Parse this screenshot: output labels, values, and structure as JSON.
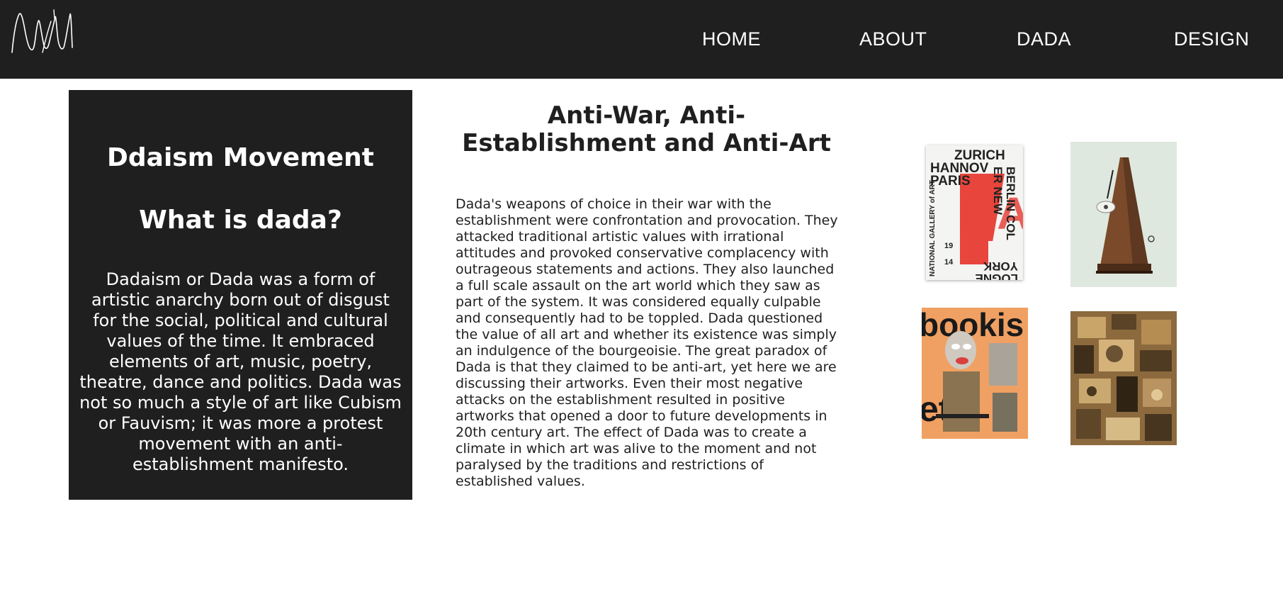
{
  "nav": {
    "logo": "logo-icon",
    "links": [
      "HOME",
      "ABOUT",
      "DADA",
      "DESIGN"
    ]
  },
  "left_panel": {
    "title": "Ddaism Movement",
    "subtitle": "What is dada?",
    "body": "Dadaism or Dada was a form of artistic anarchy born out of disgust for the social, political and cultural values of the time. It embraced elements of art, music, poetry, theatre, dance and politics. Dada was not so much a style of art like Cubism or Fauvism; it was more a protest movement with an anti-establishment manifesto."
  },
  "center": {
    "title": "Anti-War, Anti-Establishment and Anti-Art",
    "body": "Dada's weapons of choice in their war with the establishment were confrontation and provocation. They attacked traditional artistic values with irrational attitudes and provoked conservative complacency with outrageous statements and actions. They also launched a full scale assault on the art world which they saw as part of the system. It was considered equally culpable and consequently had to be toppled. Dada questioned the value of all art and whether its existence was simply an indulgence of the bourgeoisie. The great paradox of Dada is that they claimed to be anti-art, yet here we are discussing their artworks. Even their most negative attacks on the establishment resulted in positive artworks that opened a door to future developments in 20th century art. The effect of Dada was to create a climate in which art was alive to the moment and not paralysed by the traditions and restrictions of established values."
  },
  "gallery": {
    "poster": {
      "lines_left": [
        "ZURICH",
        "HANNOV",
        "PARIS"
      ],
      "lines_right": [
        "BERLIN COL",
        "ER NEW",
        "LOGNE",
        "YORK"
      ],
      "side_text": "NATIONAL GALLERY of ART",
      "date_top": "19",
      "date_bottom": "14",
      "big_letters": "DA"
    },
    "collage1_text_top": "bookis",
    "collage1_text_bottom": "eto"
  },
  "colors": {
    "dark": "#1f1f1f",
    "white": "#ffffff",
    "poster_red": "#e8453c",
    "collage_orange": "#f0a062"
  }
}
